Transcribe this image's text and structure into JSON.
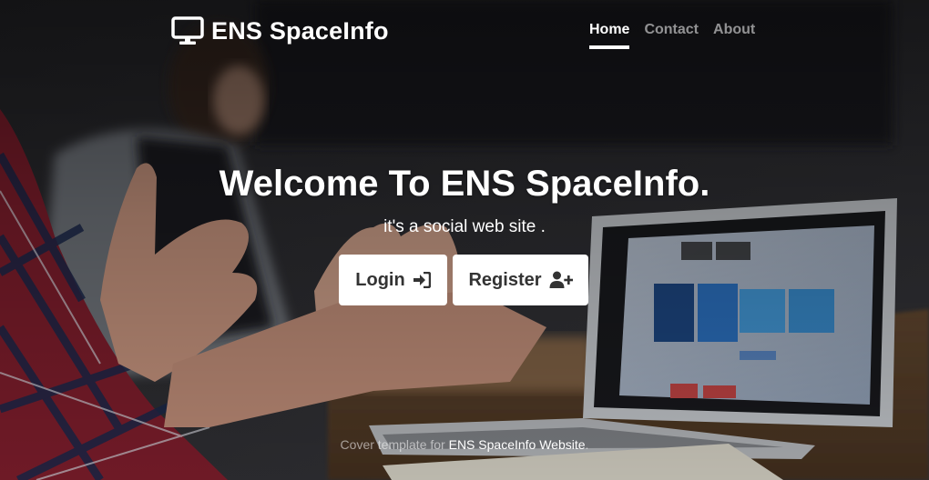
{
  "brand": {
    "title": "ENS SpaceInfo",
    "icon": "monitor-icon"
  },
  "nav": {
    "items": [
      {
        "label": "Home",
        "active": true
      },
      {
        "label": "Contact",
        "active": false
      },
      {
        "label": "About",
        "active": false
      }
    ]
  },
  "hero": {
    "title": "Welcome To ENS SpaceInfo.",
    "subtitle": "it's a social web site ."
  },
  "buttons": {
    "login": {
      "label": "Login",
      "icon": "sign-in-icon"
    },
    "register": {
      "label": "Register",
      "icon": "user-plus-icon"
    }
  },
  "footer": {
    "prefix": "Cover template for ",
    "link": "ENS SpaceInfo Website",
    "suffix": "."
  },
  "colors": {
    "button_bg": "#ffffff",
    "button_text": "#333333",
    "nav_inactive": "rgba(255,255,255,0.55)",
    "nav_active": "#ffffff"
  }
}
